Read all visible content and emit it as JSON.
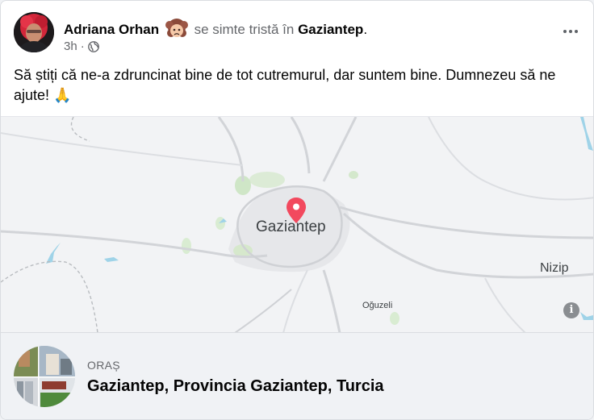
{
  "post": {
    "author": "Adriana Orhan",
    "feeling_text": "se simte tristă în",
    "place": "Gaziantep",
    "period": ".",
    "time": "3h",
    "separator": "·",
    "audience_icon": "globe-icon",
    "body": "Să știți că ne-a zdruncinat bine  de tot cutremurul, dar suntem bine. Dumnezeu să ne ajute! 🙏"
  },
  "map": {
    "city_label": "Gaziantep",
    "town_label": "Nizip",
    "village_label": "Oğuzeli",
    "info_glyph": "i",
    "pin_color": "#f2495e"
  },
  "location_card": {
    "category": "ORAȘ",
    "title": "Gaziantep, Provincia Gaziantep, Turcia"
  },
  "colors": {
    "text": "#050505",
    "secondary": "#65676b",
    "card_bg": "#ffffff",
    "footer_bg": "#f0f2f5"
  }
}
